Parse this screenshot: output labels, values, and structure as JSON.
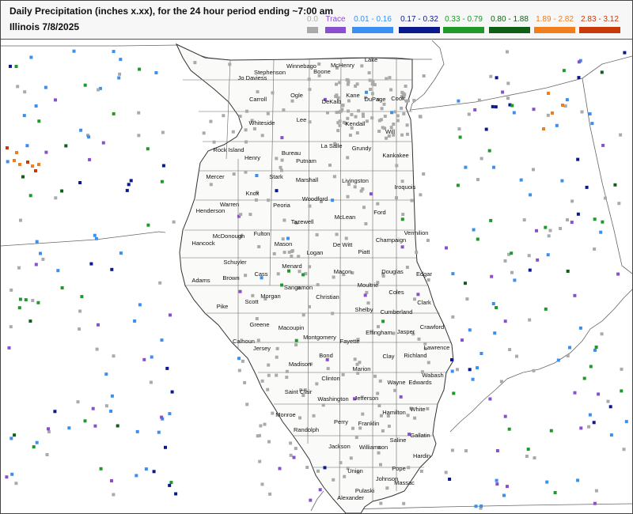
{
  "title": "Daily Precipitation (inches  x.xx),  for the 24 hour period ending ~7:00 am",
  "subtitle": "Illinois 7/8/2025",
  "legend": [
    {
      "label": "0.0",
      "color": "#aaaaaa"
    },
    {
      "label": "Trace",
      "color": "#8a4fcf"
    },
    {
      "label": "0.01 - 0.16",
      "color": "#3a8ff0"
    },
    {
      "label": "0.17 - 0.32",
      "color": "#0a1a8c"
    },
    {
      "label": "0.33 - 0.79",
      "color": "#1f9a2a"
    },
    {
      "label": "0.80 - 1.88",
      "color": "#0f5f16"
    },
    {
      "label": "1.89 - 2.82",
      "color": "#f07d1e"
    },
    {
      "label": "2.83 - 3.12",
      "color": "#c73a0a"
    }
  ],
  "counties": [
    "Jo Daviess",
    "Stephenson",
    "Winnebago",
    "Boone",
    "McHenry",
    "Lake",
    "Carroll",
    "Ogle",
    "DeKalb",
    "Kane",
    "DuPage",
    "Cook",
    "Whiteside",
    "Lee",
    "Kendall",
    "Will",
    "Rock Island",
    "Henry",
    "Bureau",
    "La Salle",
    "Grundy",
    "Kankakee",
    "Putnam",
    "Mercer",
    "Stark",
    "Marshall",
    "Livingston",
    "Iroquois",
    "Knox",
    "Woodford",
    "Warren",
    "Peoria",
    "Henderson",
    "Tazewell",
    "McLean",
    "Ford",
    "McDonough",
    "Fulton",
    "Vermilion",
    "Champaign",
    "Hancock",
    "Mason",
    "De Witt",
    "Piatt",
    "Logan",
    "Schuyler",
    "Menard",
    "Macon",
    "Douglas",
    "Edgar",
    "Adams",
    "Brown",
    "Cass",
    "Moultrie",
    "Sangamon",
    "Coles",
    "Christian",
    "Morgan",
    "Clark",
    "Pike",
    "Scott",
    "Shelby",
    "Cumberland",
    "Greene",
    "Macoupin",
    "Calhoun",
    "Montgomery",
    "Effingham",
    "Jasper",
    "Crawford",
    "Jersey",
    "Fayette",
    "Lawrence",
    "Richland",
    "Clay",
    "Madison",
    "Bond",
    "Marion",
    "Wabash",
    "Clinton",
    "Wayne",
    "Edwards",
    "Saint Clair",
    "Washington",
    "Jefferson",
    "White",
    "Hamilton",
    "Monroe",
    "Perry",
    "Franklin",
    "Randolph",
    "Gallatin",
    "Saline",
    "Jackson",
    "Williamson",
    "Hardin",
    "Pope",
    "Union",
    "Johnson",
    "Massac",
    "Pulaski",
    "Alexander"
  ]
}
